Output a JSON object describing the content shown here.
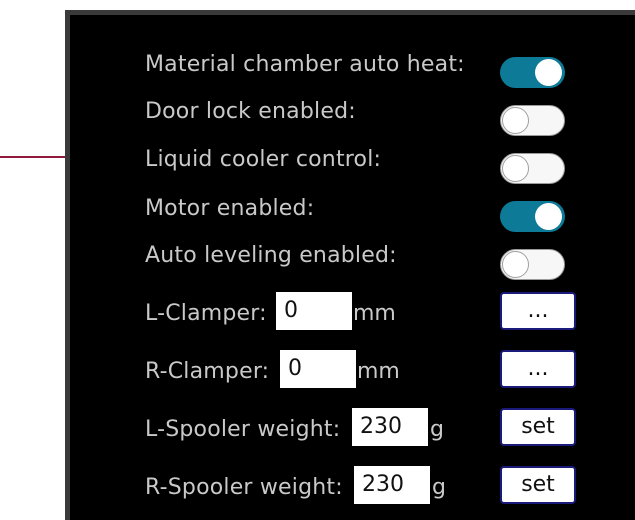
{
  "settings": {
    "auto_heat": {
      "label": "Material chamber auto heat:",
      "enabled": true
    },
    "door_lock": {
      "label": "Door lock enabled:",
      "enabled": false
    },
    "liquid_cooler": {
      "label": "Liquid cooler control:",
      "enabled": false
    },
    "motor": {
      "label": "Motor enabled:",
      "enabled": true
    },
    "auto_leveling": {
      "label": "Auto leveling enabled:",
      "enabled": false
    },
    "l_clamper": {
      "label": "L-Clamper:",
      "value": "0",
      "unit": "mm",
      "button": "..."
    },
    "r_clamper": {
      "label": "R-Clamper:",
      "value": "0",
      "unit": "mm",
      "button": "..."
    },
    "l_spooler": {
      "label": "L-Spooler weight:",
      "value": "230",
      "unit": "g",
      "button": "set"
    },
    "r_spooler": {
      "label": "R-Spooler weight:",
      "value": "230",
      "unit": "g",
      "button": "set"
    }
  },
  "colors": {
    "toggle_on": "#0d7a97",
    "toggle_off": "#f7f7f7",
    "arrow": "#8e1a3e",
    "panel": "#000000"
  }
}
